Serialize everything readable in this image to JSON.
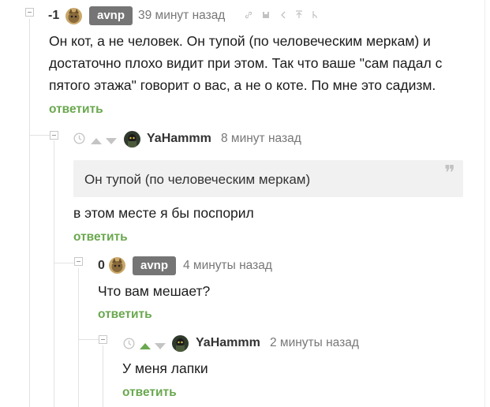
{
  "comments": [
    {
      "score": "-1",
      "username": "avnp",
      "time": "39 минут назад",
      "text_lines": [
        "Он кот, а не человек. Он тупой (по человеческим меркам) и",
        "достаточно плохо видит при этом. Так что ваше \"сам падал с",
        "пятого этажа\" говорит о вас, а не о коте. По мне это садизм."
      ],
      "reply": "ответить",
      "toolbar_icons": [
        "link-icon",
        "save-icon",
        "less-icon",
        "top-icon",
        "branch-icon"
      ]
    },
    {
      "username": "YaHammm",
      "time": "8 минут назад",
      "quote": "Он тупой (по человеческим меркам)",
      "text": "в этом месте я бы поспорил",
      "reply": "ответить"
    },
    {
      "score": "0",
      "username": "avnp",
      "time": "4 минуты назад",
      "text": "Что вам мешает?",
      "reply": "ответить"
    },
    {
      "username": "YaHammm",
      "time": "2 минуты назад",
      "text": "У меня лапки",
      "reply": "ответить"
    }
  ],
  "colors": {
    "accent_green": "#6aa84f",
    "badge_gray": "#757575",
    "muted_gray": "#777777"
  }
}
